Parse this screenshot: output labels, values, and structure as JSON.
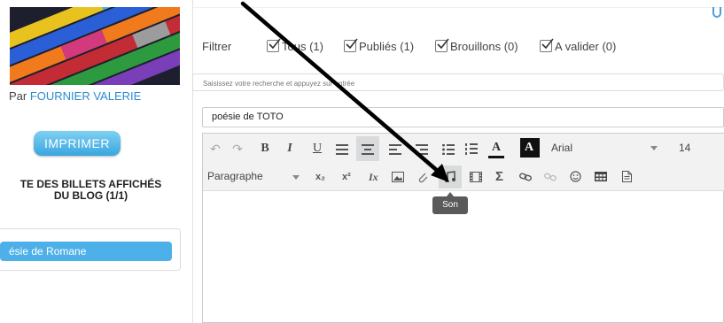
{
  "sidebar": {
    "byline_prefix": "Par ",
    "author": "FOURNIER VALERIE",
    "print_button": "IMPRIMER",
    "list_title_line1": "TE DES BILLETS AFFICHÉS",
    "list_title_line2": "DU BLOG (1/1)",
    "list_items": [
      "ésie de Romane"
    ]
  },
  "filters": {
    "label": "Filtrer",
    "options": [
      {
        "label": "Tous (1)",
        "checked": true
      },
      {
        "label": "Publiés (1)",
        "checked": true
      },
      {
        "label": "Brouillons (0)",
        "checked": true
      },
      {
        "label": "A valider (0)",
        "checked": true
      }
    ]
  },
  "search": {
    "placeholder": "Saisissez votre recherche et appuyez sur entrée"
  },
  "post": {
    "title": "poésie de TOTO"
  },
  "editor": {
    "font_family": "Arial",
    "font_size": "14",
    "format": "Paragraphe",
    "bold": "B",
    "italic": "I",
    "underline": "U",
    "text_color_glyph": "A",
    "bg_color_glyph": "A",
    "sigma": "Σ",
    "subscript": "x₂",
    "superscript": "x²",
    "clear_format": "Ix"
  },
  "tooltip": {
    "text": "Son"
  },
  "colors": {
    "accent": "#4eb0e8",
    "link": "#2a8ccf",
    "tooltip": "#5a5a5a"
  }
}
